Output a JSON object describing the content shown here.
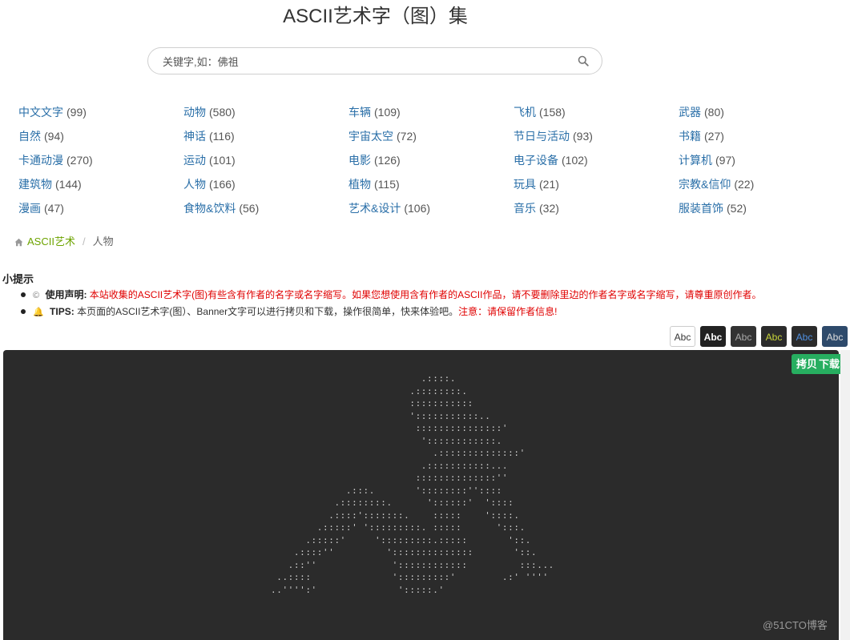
{
  "site": {
    "title": "ASCII艺术字（图）集"
  },
  "search": {
    "placeholder": "关键字,如：佛祖",
    "icon": "search-icon"
  },
  "categories": [
    {
      "name": "中文文字",
      "count": "(99)"
    },
    {
      "name": "动物",
      "count": "(580)"
    },
    {
      "name": "车辆",
      "count": "(109)"
    },
    {
      "name": "飞机",
      "count": "(158)"
    },
    {
      "name": "武器",
      "count": "(80)"
    },
    {
      "name": "自然",
      "count": "(94)"
    },
    {
      "name": "神话",
      "count": "(116)"
    },
    {
      "name": "宇宙太空",
      "count": "(72)"
    },
    {
      "name": "节日与活动",
      "count": "(93)"
    },
    {
      "name": "书籍",
      "count": "(27)"
    },
    {
      "name": "卡通动漫",
      "count": "(270)"
    },
    {
      "name": "运动",
      "count": "(101)"
    },
    {
      "name": "电影",
      "count": "(126)"
    },
    {
      "name": "电子设备",
      "count": "(102)"
    },
    {
      "name": "计算机",
      "count": "(97)"
    },
    {
      "name": "建筑物",
      "count": "(144)"
    },
    {
      "name": "人物",
      "count": "(166)"
    },
    {
      "name": "植物",
      "count": "(115)"
    },
    {
      "name": "玩具",
      "count": "(21)"
    },
    {
      "name": "宗教&信仰",
      "count": "(22)"
    },
    {
      "name": "漫画",
      "count": "(47)"
    },
    {
      "name": "食物&饮料",
      "count": "(56)"
    },
    {
      "name": "艺术&设计",
      "count": "(106)"
    },
    {
      "name": "音乐",
      "count": "(32)"
    },
    {
      "name": "服装首饰",
      "count": "(52)"
    }
  ],
  "breadcrumb": {
    "home": "ASCII艺术",
    "separator": "/",
    "current": "人物",
    "icon": "home-icon"
  },
  "tips": {
    "title": "小提示",
    "declaration": {
      "icon": "copyright-icon",
      "icon_glyph": "©",
      "label": "使用声明:",
      "text": "本站收集的ASCII艺术字(图)有些含有作者的名字或名字缩写。如果您想使用含有作者的ASCII作品，请不要删除里边的作者名字或名字缩写，请尊重原创作者。"
    },
    "tip": {
      "icon": "bell-icon",
      "icon_glyph": "🔔",
      "label": "TIPS:",
      "text": "本页面的ASCII艺术字(图）、Banner文字可以进行拷贝和下载，操作很简单，快来体验吧。",
      "warning": "注意：请保留作者信息!"
    }
  },
  "themes": [
    {
      "label": "Abc",
      "bg": "#ffffff",
      "fg": "#333333",
      "border": "#cccccc"
    },
    {
      "label": "Abc",
      "bg": "#222222",
      "fg": "#ffffff",
      "border": "#222222"
    },
    {
      "label": "Abc",
      "bg": "#333333",
      "fg": "#aaaaaa",
      "border": "#333333"
    },
    {
      "label": "Abc",
      "bg": "#2b2b2b",
      "fg": "#c8d43a",
      "border": "#2b2b2b"
    },
    {
      "label": "Abc",
      "bg": "#2b2b2b",
      "fg": "#4f8fe0",
      "border": "#2b2b2b"
    },
    {
      "label": "Abc",
      "bg": "#2e4a6b",
      "fg": "#dddddd",
      "border": "#2e4a6b"
    }
  ],
  "actions": {
    "copy": "拷贝",
    "download": "下载"
  },
  "ascii_art": [
    "                          .::::.",
    "                        .::::::::.",
    "                        :::::::::::",
    "                        ':::::::::::..",
    "                         :::::::::::::::'",
    "                          '::::::::::::.",
    "                            .::::::::::::::'",
    "                          .:::::::::::...",
    "                         ::::::::::::::''",
    "             .:::.       '::::::::''::::",
    "           .::::::::.      '::::::'  '::::",
    "          .::::':::::::.    :::::    '::::.",
    "        .:::::' ':::::::::. :::::      ':::.",
    "      .:::::'     ':::::::::.:::::       '::.",
    "    .::::''         '::::::::::::::       '::.",
    "   .::''             '::::::::::::         :::...",
    " ..::::              ':::::::::'        .:' ''''",
    "..'''':'              ':::::.'"
  ],
  "watermark": "@51CTO博客"
}
